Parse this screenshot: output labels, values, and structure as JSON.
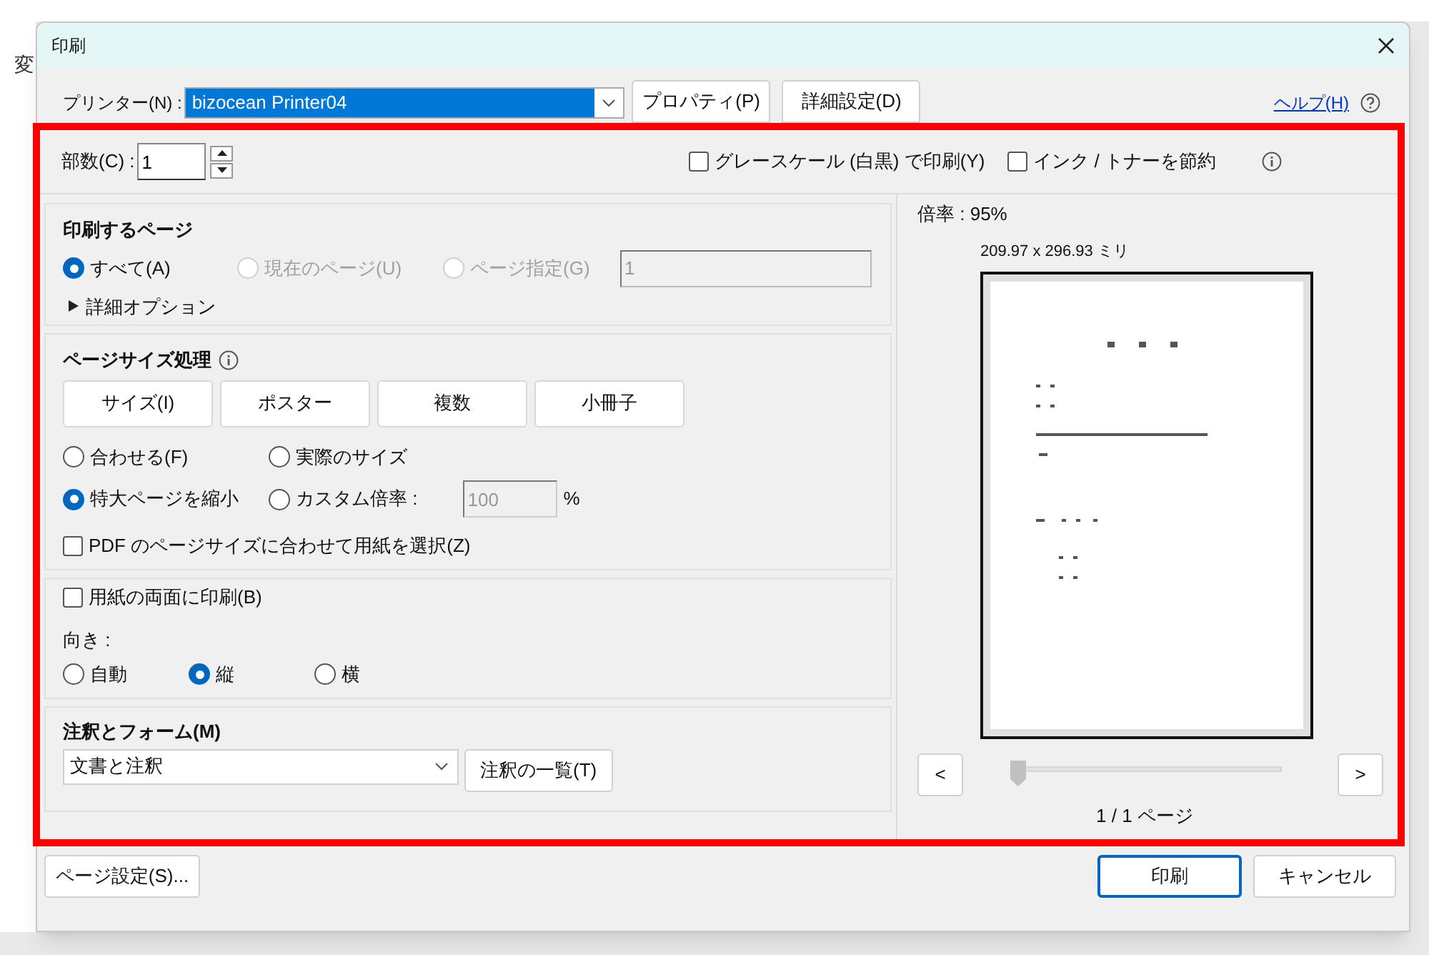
{
  "background": {
    "text": "変"
  },
  "window": {
    "title": "印刷"
  },
  "printer": {
    "label": "プリンター(N) :",
    "value": "bizocean Printer04",
    "buttons": [
      "プロパティ(P)",
      "詳細設定(D)"
    ],
    "help_link": "ヘルプ(H)"
  },
  "copies": {
    "label": "部数(C) :",
    "value": "1"
  },
  "top_options": [
    {
      "label": "グレースケール (白黒) で印刷(Y)",
      "checked": false
    },
    {
      "label": "インク / トナーを節約",
      "checked": false
    }
  ],
  "pages_section": {
    "title": "印刷するページ",
    "options": [
      {
        "label": "すべて(A)",
        "selected": true,
        "disabled": false
      },
      {
        "label": "現在のページ(U)",
        "selected": false,
        "disabled": true
      },
      {
        "label": "ページ指定(G)",
        "selected": false,
        "disabled": true
      }
    ],
    "range_value": "1",
    "more_options": {
      "label": "詳細オプション",
      "expanded": false
    }
  },
  "size_section": {
    "title": "ページサイズ処理",
    "modes": [
      {
        "label": "サイズ(I)",
        "selected": false
      },
      {
        "label": "ポスター",
        "selected": false
      },
      {
        "label": "複数",
        "selected": false
      },
      {
        "label": "小冊子",
        "selected": false
      }
    ],
    "options": [
      {
        "label": "合わせる(F)",
        "selected": false
      },
      {
        "label": "実際のサイズ",
        "selected": false
      },
      {
        "label": "特大ページを縮小",
        "selected": true
      },
      {
        "label": "カスタム倍率 :",
        "selected": false
      }
    ],
    "scale_value": "100",
    "scale_unit": "%",
    "pdf_paper": {
      "label": "PDF のページサイズに合わせて用紙を選択(Z)",
      "checked": false
    }
  },
  "duplex": {
    "label": "用紙の両面に印刷(B)",
    "checked": false
  },
  "orientation": {
    "label": "向き :",
    "options": [
      {
        "label": "自動",
        "selected": false
      },
      {
        "label": "縦",
        "selected": true
      },
      {
        "label": "横",
        "selected": false
      }
    ]
  },
  "annotations": {
    "title": "注釈とフォーム(M)",
    "value": "文書と注釈",
    "button": "注釈の一覧(T)"
  },
  "preview": {
    "zoom": "倍率 : 95%",
    "dimensions": "209.97 x 296.93 ミリ",
    "prev": "<",
    "next": ">",
    "level": 0,
    "page": "1 / 1 ページ"
  },
  "footer": {
    "page_setup": "ページ設定(S)...",
    "print": "印刷",
    "cancel": "キャンセル"
  }
}
